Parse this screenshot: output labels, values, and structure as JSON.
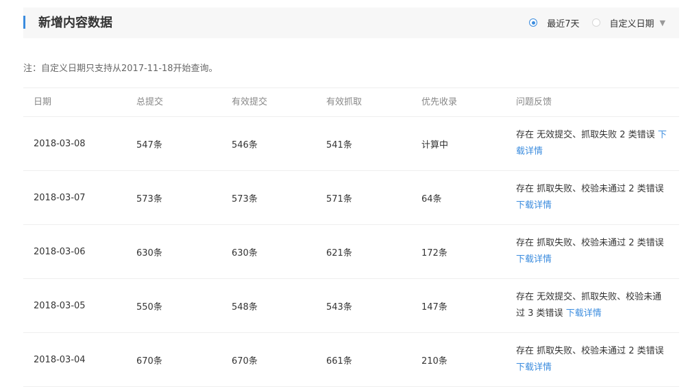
{
  "header": {
    "title": "新增内容数据",
    "options": [
      {
        "label": "最近7天",
        "selected": true
      },
      {
        "label": "自定义日期",
        "selected": false
      }
    ],
    "caret": "▼"
  },
  "note": "注：自定义日期只支持从2017-11-18开始查询。",
  "table": {
    "columns": [
      "日期",
      "总提交",
      "有效提交",
      "有效抓取",
      "优先收录",
      "问题反馈"
    ],
    "rows": [
      {
        "date": "2018-03-08",
        "total": "547条",
        "valid_submit": "546条",
        "valid_crawl": "541条",
        "priority": "计算中",
        "feedback": "存在 无效提交、抓取失败 2 类错误",
        "link": "下载详情"
      },
      {
        "date": "2018-03-07",
        "total": "573条",
        "valid_submit": "573条",
        "valid_crawl": "571条",
        "priority": "64条",
        "feedback": "存在 抓取失败、校验未通过 2 类错误",
        "link": "下载详情"
      },
      {
        "date": "2018-03-06",
        "total": "630条",
        "valid_submit": "630条",
        "valid_crawl": "621条",
        "priority": "172条",
        "feedback": "存在 抓取失败、校验未通过 2 类错误",
        "link": "下载详情"
      },
      {
        "date": "2018-03-05",
        "total": "550条",
        "valid_submit": "548条",
        "valid_crawl": "543条",
        "priority": "147条",
        "feedback": "存在 无效提交、抓取失败、校验未通过 3 类错误",
        "link": "下载详情"
      },
      {
        "date": "2018-03-04",
        "total": "670条",
        "valid_submit": "670条",
        "valid_crawl": "661条",
        "priority": "210条",
        "feedback": "存在 抓取失败、校验未通过 2 类错误",
        "link": "下载详情"
      }
    ]
  },
  "colors": {
    "accent": "#3b8cde",
    "header_bg": "#f7f7f7",
    "border": "#eeeeee",
    "muted_text": "#888888"
  }
}
